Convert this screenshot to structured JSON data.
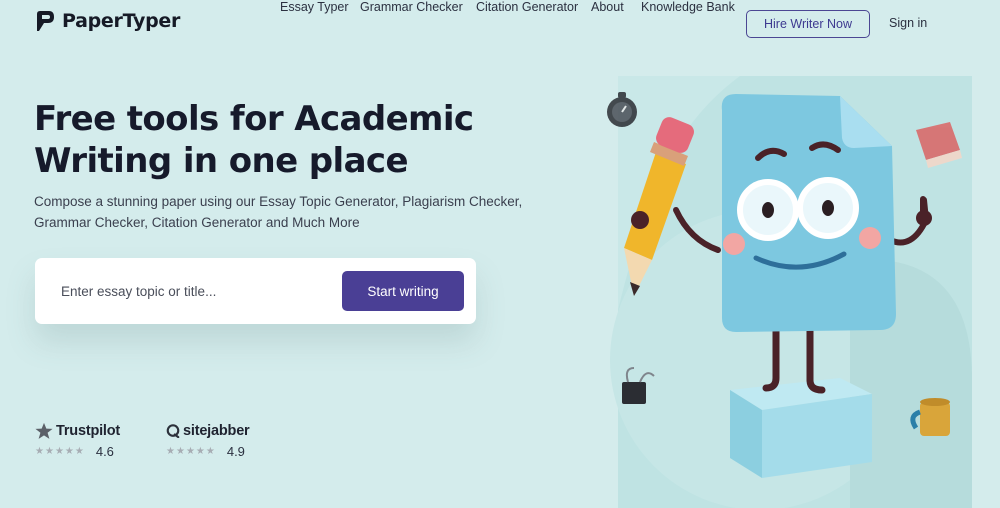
{
  "header": {
    "brand": "PaperTyper",
    "nav": [
      {
        "label": "Essay Typer"
      },
      {
        "label": "Grammar Checker"
      },
      {
        "label": "Citation Generator"
      },
      {
        "label": "About"
      },
      {
        "label": "Knowledge Bank"
      }
    ],
    "cta_label": "Hire Writer Now",
    "signin_label": "Sign in"
  },
  "hero": {
    "title_line1": "Free tools for Academic",
    "title_line2": "Writing in one place",
    "subtitle": "Compose a stunning paper using our Essay Topic Generator, Plagiarism Checker, Grammar Checker, Citation Generator and Much More",
    "search_placeholder": "Enter essay topic or title...",
    "search_button": "Start writing"
  },
  "ratings": [
    {
      "brand": "Trustpilot",
      "score": "4.6",
      "stars": 5,
      "icon": "trustpilot-star-icon"
    },
    {
      "brand": "sitejabber",
      "score": "4.9",
      "stars": 5,
      "icon": "sitejabber-icon"
    }
  ],
  "colors": {
    "background": "#d4ecec",
    "primary_button": "#4a3f95",
    "heading": "#161a2b",
    "illustration_shape": "#bfe2e2"
  }
}
